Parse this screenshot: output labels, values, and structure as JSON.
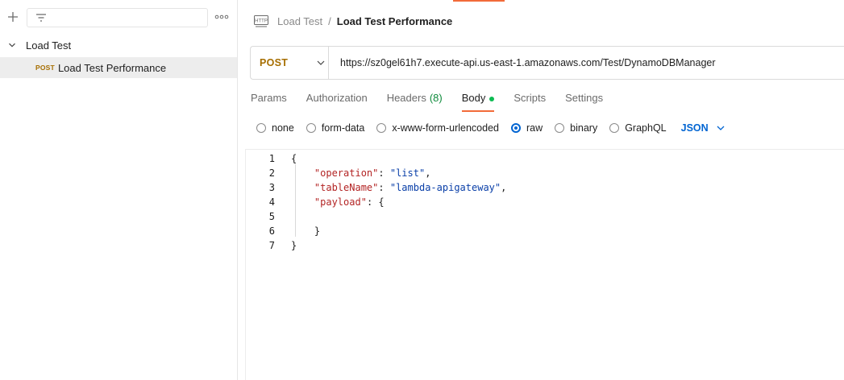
{
  "sidebar": {
    "collection": {
      "name": "Load Test"
    },
    "request": {
      "method": "POST",
      "name": "Load Test Performance"
    }
  },
  "breadcrumb": {
    "parent": "Load Test",
    "separator": "/",
    "current": "Load Test Performance"
  },
  "request": {
    "method": "POST",
    "url": "https://sz0gel61h7.execute-api.us-east-1.amazonaws.com/Test/DynamoDBManager"
  },
  "tabs": [
    {
      "label": "Params"
    },
    {
      "label": "Authorization"
    },
    {
      "label": "Headers",
      "count": "(8)"
    },
    {
      "label": "Body"
    },
    {
      "label": "Scripts"
    },
    {
      "label": "Settings"
    }
  ],
  "body_options": {
    "items": [
      {
        "label": "none",
        "selected": false
      },
      {
        "label": "form-data",
        "selected": false
      },
      {
        "label": "x-www-form-urlencoded",
        "selected": false
      },
      {
        "label": "raw",
        "selected": true
      },
      {
        "label": "binary",
        "selected": false
      },
      {
        "label": "GraphQL",
        "selected": false
      }
    ],
    "language": "JSON"
  },
  "editor": {
    "line_numbers": [
      "1",
      "2",
      "3",
      "4",
      "5",
      "6",
      "7"
    ],
    "tokens": {
      "open_brace": "{",
      "k_operation": "\"operation\"",
      "v_operation": "\"list\"",
      "k_tableName": "\"tableName\"",
      "v_tableName": "\"lambda-apigateway\"",
      "k_payload": "\"payload\"",
      "inner_open": "{",
      "inner_close": "}",
      "close_brace": "}",
      "colon": ": ",
      "comma": ","
    }
  },
  "colors": {
    "accent": "#f26b3a",
    "method_post": "#a66e00",
    "link_blue": "#0265d2",
    "json_key": "#b32424",
    "json_string": "#0a3fa8",
    "status_green": "#0cbb52"
  }
}
